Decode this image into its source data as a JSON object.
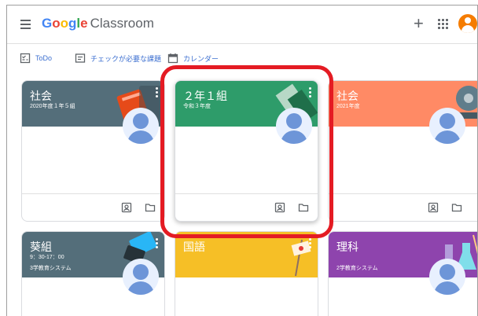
{
  "app": {
    "brand_google": "Google",
    "brand_product": "Classroom"
  },
  "toolbar": {
    "todo": "ToDo",
    "review": "チェックが必要な課題",
    "calendar": "カレンダー"
  },
  "cards": [
    {
      "title": "社会",
      "subtitle": "2020年度１年５組",
      "section": "",
      "color": "#546e7a"
    },
    {
      "title": "２年１組",
      "subtitle": "令和３年度",
      "section": "",
      "color": "#2e9c6a"
    },
    {
      "title": "社会",
      "subtitle": "2021年度",
      "section": "",
      "color": "#ff8a65"
    },
    {
      "title": "葵組",
      "subtitle": "9：30-17：00",
      "section": "3学教育システム",
      "color": "#546e7a"
    },
    {
      "title": "国語",
      "subtitle": "",
      "section": "",
      "color": "#f6bf26"
    },
    {
      "title": "理科",
      "subtitle": "2学教育システム",
      "section": "",
      "color": "#8e44ad"
    }
  ],
  "icons": {
    "menu": "hamburger-menu-icon",
    "add": "plus-icon",
    "apps": "apps-grid-icon",
    "account": "account-avatar-icon",
    "todo": "todo-checklist-icon",
    "review": "review-tray-icon",
    "calendar": "calendar-icon",
    "assignments": "assignment-person-icon",
    "folder": "folder-icon"
  },
  "colors": {
    "highlight": "#e41b23",
    "link": "#3c6fd0"
  }
}
